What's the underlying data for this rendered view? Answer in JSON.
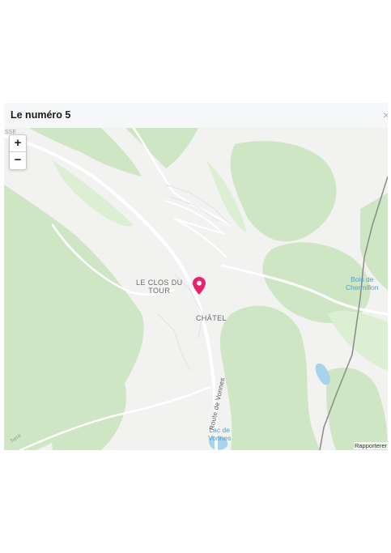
{
  "modal": {
    "title": "Le numéro 5",
    "close_label": "×"
  },
  "map": {
    "zoom_in_label": "+",
    "zoom_out_label": "−",
    "labels": {
      "clos_du_tour": "LE CLOS DU\nTOUR",
      "chatel": "CHÂTEL",
      "bois_de_chermillon": "Bois de\nChermillon",
      "lac_de_vonnes": "Lac de\nVonnes",
      "route_de_vonnes": "Route  de  Vonnes",
      "corner_top": "SSE",
      "corner_bottom": "here"
    },
    "attribution": "Rapporterer",
    "colors": {
      "background": "#f2f2f1",
      "forest": "#cfe6c5",
      "forest_light": "#dcefd3",
      "water": "#a9d3ea",
      "marker": "#e8226c",
      "road": "#ffffff",
      "boundary": "#8a8a8a"
    },
    "marker_icon": "map-pin-icon"
  }
}
